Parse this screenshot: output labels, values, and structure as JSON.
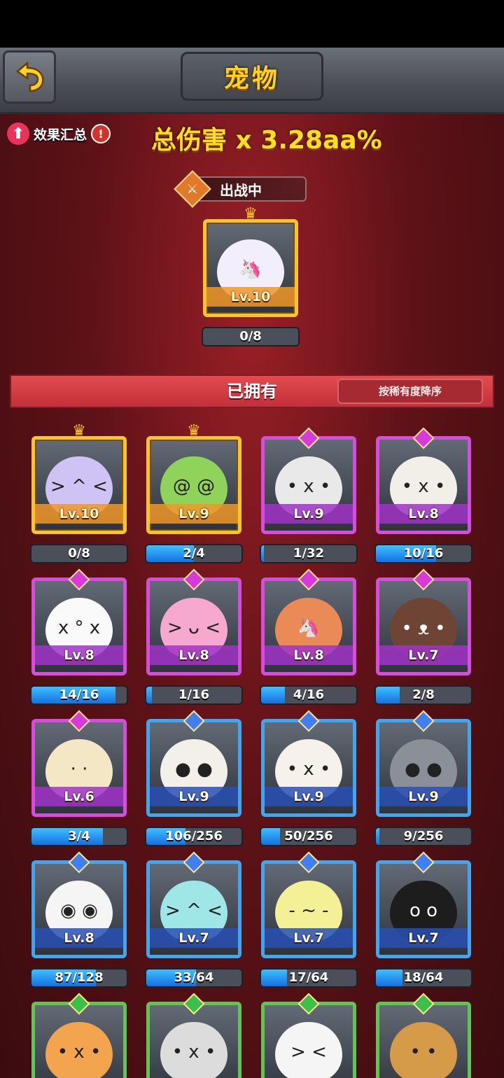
{
  "header": {
    "title": "宠物"
  },
  "effect": {
    "label": "效果汇总",
    "total_damage": "总伤害 x 3.28aa%"
  },
  "deployed": {
    "badge_label": "出战中",
    "pet": {
      "level": "Lv.10",
      "progress_text": "0/8",
      "progress": 0,
      "rarity": "gold",
      "color": "#f3eefb",
      "face": "🦄"
    }
  },
  "owned": {
    "title": "已拥有",
    "sort_label": "按稀有度降序",
    "pets": [
      {
        "level": "Lv.10",
        "progress_text": "0/8",
        "progress": 0,
        "rarity": "gold",
        "color": "#cfc2f4",
        "face": "> ^ <"
      },
      {
        "level": "Lv.9",
        "progress_text": "2/4",
        "progress": 0.5,
        "rarity": "gold",
        "color": "#8fd35a",
        "face": "@ @"
      },
      {
        "level": "Lv.9",
        "progress_text": "1/32",
        "progress": 0.03,
        "rarity": "purple",
        "color": "#e9e9e9",
        "face": "• x •"
      },
      {
        "level": "Lv.8",
        "progress_text": "10/16",
        "progress": 0.63,
        "rarity": "purple",
        "color": "#f2efe8",
        "face": "• x •"
      },
      {
        "level": "Lv.8",
        "progress_text": "14/16",
        "progress": 0.88,
        "rarity": "purple",
        "color": "#fafafa",
        "face": "x ° x"
      },
      {
        "level": "Lv.8",
        "progress_text": "1/16",
        "progress": 0.06,
        "rarity": "purple",
        "color": "#f6a8cf",
        "face": "> ᴗ <"
      },
      {
        "level": "Lv.8",
        "progress_text": "4/16",
        "progress": 0.25,
        "rarity": "purple",
        "color": "#e98a57",
        "face": "🦄"
      },
      {
        "level": "Lv.7",
        "progress_text": "2/8",
        "progress": 0.25,
        "rarity": "purple",
        "color": "#6e4535",
        "face": "• ᴥ •"
      },
      {
        "level": "Lv.6",
        "progress_text": "3/4",
        "progress": 0.75,
        "rarity": "purple",
        "color": "#f4e7c6",
        "face": "· ·"
      },
      {
        "level": "Lv.9",
        "progress_text": "106/256",
        "progress": 0.41,
        "rarity": "blue",
        "color": "#f3f0ea",
        "face": "● ●"
      },
      {
        "level": "Lv.9",
        "progress_text": "50/256",
        "progress": 0.2,
        "rarity": "blue",
        "color": "#f6f1ea",
        "face": "• x •"
      },
      {
        "level": "Lv.9",
        "progress_text": "9/256",
        "progress": 0.04,
        "rarity": "blue",
        "color": "#8a8f98",
        "face": "● ●"
      },
      {
        "level": "Lv.8",
        "progress_text": "87/128",
        "progress": 0.68,
        "rarity": "blue",
        "color": "#f5f5f5",
        "face": "◉ ◉"
      },
      {
        "level": "Lv.7",
        "progress_text": "33/64",
        "progress": 0.52,
        "rarity": "blue",
        "color": "#9fe6e6",
        "face": "> ^ <"
      },
      {
        "level": "Lv.7",
        "progress_text": "17/64",
        "progress": 0.27,
        "rarity": "blue",
        "color": "#f4f096",
        "face": "- ~ -"
      },
      {
        "level": "Lv.7",
        "progress_text": "18/64",
        "progress": 0.28,
        "rarity": "blue",
        "color": "#1d1d1d",
        "face": "o o"
      },
      {
        "level": "",
        "progress_text": "",
        "progress": 0,
        "rarity": "green",
        "color": "#f2a44e",
        "face": "• x •"
      },
      {
        "level": "",
        "progress_text": "",
        "progress": 0,
        "rarity": "green",
        "color": "#dcdcdc",
        "face": "• x •"
      },
      {
        "level": "",
        "progress_text": "",
        "progress": 0,
        "rarity": "green",
        "color": "#f5f5f5",
        "face": "> <"
      },
      {
        "level": "",
        "progress_text": "",
        "progress": 0,
        "rarity": "green",
        "color": "#d69b48",
        "face": "• •"
      }
    ]
  }
}
